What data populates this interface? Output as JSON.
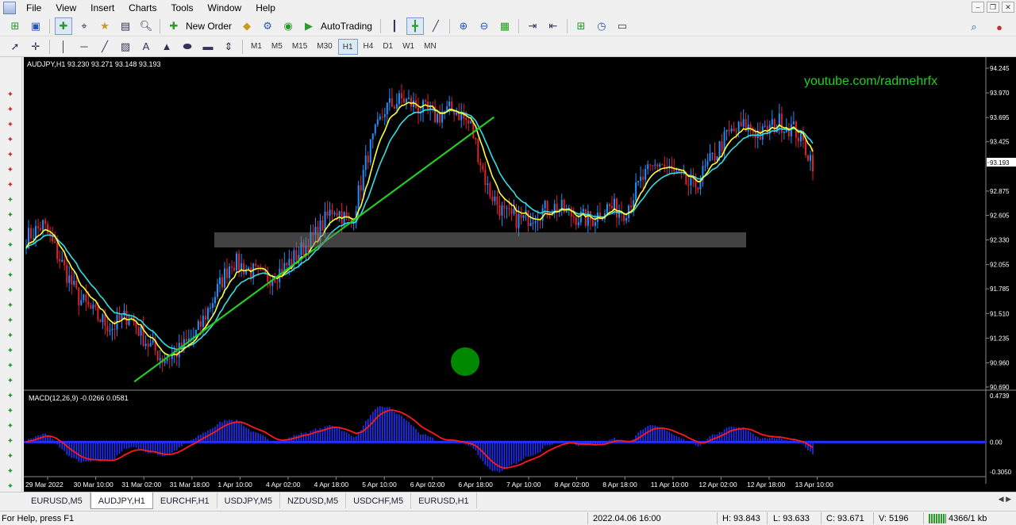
{
  "menu": {
    "items": [
      "File",
      "View",
      "Insert",
      "Charts",
      "Tools",
      "Window",
      "Help"
    ]
  },
  "toolbar": {
    "new_order_label": "New Order",
    "autotrading_label": "AutoTrading",
    "timeframes": [
      "M1",
      "M5",
      "M15",
      "M30",
      "H1",
      "H4",
      "D1",
      "W1",
      "MN"
    ],
    "active_timeframe": "H1"
  },
  "chart": {
    "header": "AUDJPY,H1  93.230 93.271 93.148 93.193",
    "watermark_url": "youtube.com/radmehrfx",
    "macd_header": "MACD(12,26,9) -0.0266 0.0581",
    "current_price_label": "93.193",
    "colors": {
      "background": "#000000",
      "bull_candle": "#1e90ff",
      "bear_candle": "#e0202a",
      "ma_fast": "#ffff33",
      "ma_slow": "#33e0e0",
      "trendline": "#22cc22",
      "macd_hist": "#2030ff",
      "macd_signal": "#ff1a1a"
    }
  },
  "chart_data": {
    "type": "line",
    "symbol": "AUDJPY",
    "timeframe": "H1",
    "price_axis_ticks": [
      "94.245",
      "93.970",
      "93.695",
      "93.425",
      "93.193",
      "92.875",
      "92.605",
      "92.330",
      "92.055",
      "91.785",
      "91.510",
      "91.235",
      "90.960",
      "90.690"
    ],
    "ylim": [
      90.69,
      94.245
    ],
    "time_axis_ticks": [
      "29 Mar 2022",
      "30 Mar 10:00",
      "31 Mar 02:00",
      "31 Mar 18:00",
      "1 Apr 10:00",
      "4 Apr 02:00",
      "4 Apr 18:00",
      "5 Apr 10:00",
      "6 Apr 02:00",
      "6 Apr 18:00",
      "7 Apr 10:00",
      "8 Apr 02:00",
      "8 Apr 18:00",
      "11 Apr 10:00",
      "12 Apr 02:00",
      "12 Apr 18:00",
      "13 Apr 10:00"
    ],
    "price_path": [
      92.35,
      92.5,
      92.1,
      91.7,
      91.5,
      91.35,
      91.5,
      91.2,
      91.0,
      91.1,
      91.3,
      91.7,
      92.1,
      92.0,
      91.9,
      92.0,
      92.2,
      92.4,
      92.7,
      92.5,
      93.3,
      93.8,
      93.9,
      93.8,
      93.7,
      93.8,
      93.6,
      92.9,
      92.6,
      92.55,
      92.65,
      92.7,
      92.6,
      92.55,
      92.7,
      92.65,
      93.0,
      93.2,
      93.05,
      92.9,
      93.2,
      93.5,
      93.6,
      93.5,
      93.65,
      93.55,
      93.2
    ],
    "trendline": {
      "from": [
        "31 Mar 02:00",
        90.75
      ],
      "to": [
        "6 Apr 18:00",
        93.7
      ]
    },
    "macd_axis_ticks": [
      "0.4739",
      "0.00",
      "-0.3050"
    ],
    "macd_ylim": [
      -0.305,
      0.4739
    ]
  },
  "tabs": [
    "EURUSD,M5",
    "AUDJPY,H1",
    "EURCHF,H1",
    "USDJPY,M5",
    "NZDUSD,M5",
    "USDCHF,M5",
    "EURUSD,H1"
  ],
  "active_tab": "AUDJPY,H1",
  "status": {
    "help": "For Help, press F1",
    "datetime": "2022.04.06 16:00",
    "high": "H: 93.843",
    "low": "L: 93.633",
    "close": "C: 93.671",
    "volume": "V: 5196",
    "traffic": "4366/1 kb"
  }
}
